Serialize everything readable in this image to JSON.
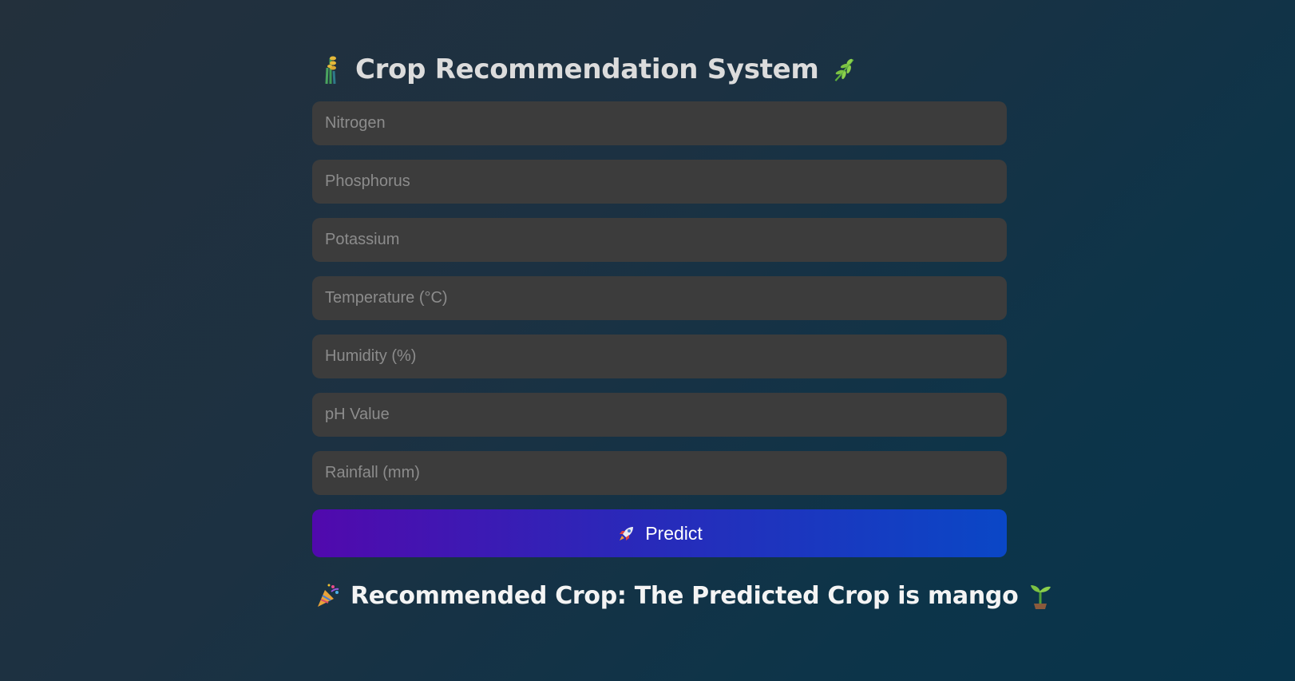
{
  "header": {
    "title": "Crop Recommendation System",
    "left_icon": "wheat-icon",
    "right_icon": "herb-icon"
  },
  "form": {
    "fields": [
      {
        "placeholder": "Nitrogen",
        "value": ""
      },
      {
        "placeholder": "Phosphorus",
        "value": ""
      },
      {
        "placeholder": "Potassium",
        "value": ""
      },
      {
        "placeholder": "Temperature (°C)",
        "value": ""
      },
      {
        "placeholder": "Humidity (%)",
        "value": ""
      },
      {
        "placeholder": "pH Value",
        "value": ""
      },
      {
        "placeholder": "Rainfall (mm)",
        "value": ""
      }
    ],
    "predict_label": "Predict",
    "predict_icon": "rocket-icon"
  },
  "result": {
    "text": "Recommended Crop: The Predicted Crop is mango",
    "left_icon": "party-popper-icon",
    "right_icon": "seedling-icon"
  },
  "colors": {
    "background_start": "#23303c",
    "background_end": "#08344b",
    "field_bg": "#3c3c3c",
    "button_gradient_start": "#5109ad",
    "button_gradient_end": "#0a47c6"
  }
}
